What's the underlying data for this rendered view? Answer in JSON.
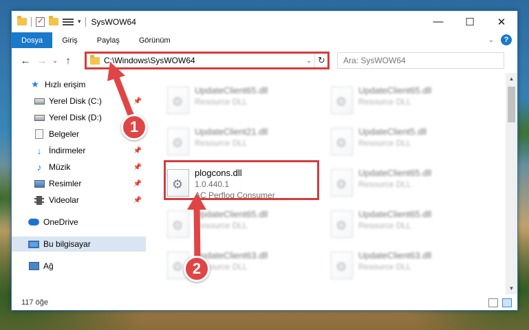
{
  "window": {
    "title": "SysWOW64"
  },
  "ribbon": {
    "tabs": [
      "Dosya",
      "Giriş",
      "Paylaş",
      "Görünüm"
    ]
  },
  "address": {
    "path": "C:\\Windows\\SysWOW64",
    "search_placeholder": "Ara: SysWOW64"
  },
  "sidebar": {
    "items": [
      {
        "label": "Hızlı erişim",
        "icon": "star-icon"
      },
      {
        "label": "Yerel Disk (C:)",
        "icon": "disk-icon",
        "pinned": true
      },
      {
        "label": "Yerel Disk (D:)",
        "icon": "disk-icon"
      },
      {
        "label": "Belgeler",
        "icon": "documents-icon"
      },
      {
        "label": "İndirmeler",
        "icon": "download-icon",
        "pinned": true
      },
      {
        "label": "Müzik",
        "icon": "music-icon",
        "pinned": true
      },
      {
        "label": "Resimler",
        "icon": "pictures-icon",
        "pinned": true
      },
      {
        "label": "Videolar",
        "icon": "videos-icon",
        "pinned": true
      },
      {
        "label": "OneDrive",
        "icon": "onedrive-icon"
      },
      {
        "label": "Bu bilgisayar",
        "icon": "this-pc-icon",
        "selected": true
      },
      {
        "label": "Ağ",
        "icon": "network-icon"
      }
    ]
  },
  "files": [
    {
      "name": "UpdateClient65.dll",
      "desc": "Resource DLL",
      "blurred": true
    },
    {
      "name": "UpdateClient65.dll",
      "desc": "Resource DLL",
      "blurred": true
    },
    {
      "name": "UpdateClient21.dll",
      "desc": "Resource DLL",
      "blurred": true
    },
    {
      "name": "UpdateClient5.dll",
      "desc": "Resource DLL",
      "blurred": true
    },
    {
      "name": "plogcons.dll",
      "version": "1.0.440.1",
      "desc": "AC Perflog Consumer",
      "blurred": false
    },
    {
      "name": "UpdateClient65.dll",
      "desc": "Resource DLL",
      "blurred": true
    },
    {
      "name": "UpdateClient65.dll",
      "desc": "Resource DLL",
      "blurred": true
    },
    {
      "name": "UpdateClient65.dll",
      "desc": "Resource DLL",
      "blurred": true
    },
    {
      "name": "UpdateClient63.dll",
      "desc": "Resource DLL",
      "blurred": true
    },
    {
      "name": "UpdateClient63.dll",
      "desc": "Resource DLL",
      "blurred": true
    }
  ],
  "status": {
    "count": "117 öğe"
  },
  "annotations": {
    "step1": "1",
    "step2": "2",
    "color": "#e04545"
  }
}
